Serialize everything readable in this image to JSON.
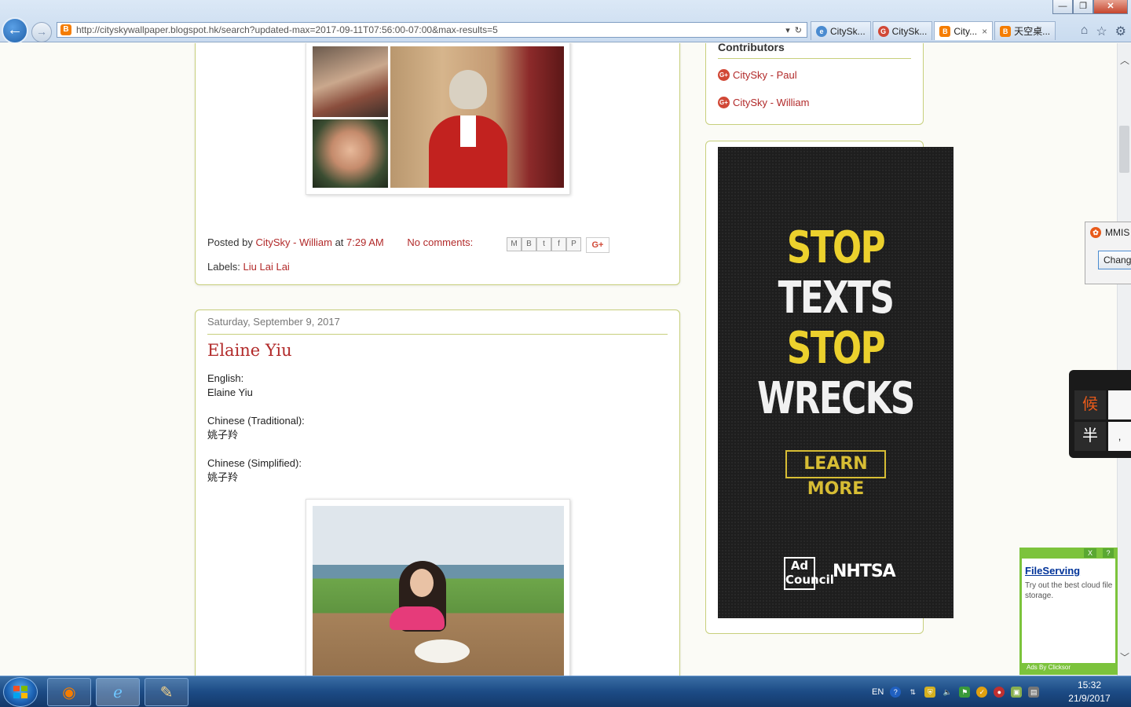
{
  "browser": {
    "url": "http://cityskywallpaper.blogspot.hk/search?updated-max=2017-09-11T07:56:00-07:00&max-results=5",
    "tabs": [
      {
        "label": "CitySk..."
      },
      {
        "label": "CitySk..."
      },
      {
        "label": "City...",
        "close": "×"
      },
      {
        "label": "天空桌..."
      }
    ],
    "window_controls": {
      "minimize": "—",
      "maximize": "❐",
      "close": "✕"
    }
  },
  "post_prev": {
    "posted_by_prefix": "Posted by",
    "author": "CitySky - William",
    "at": "at",
    "time": "7:29 AM",
    "comments": "No comments:",
    "share": {
      "email": "M",
      "blog": "B",
      "twitter": "t",
      "facebook": "f",
      "pinterest": "P",
      "gplus": "G+"
    },
    "labels_prefix": "Labels:",
    "label": "Liu Lai Lai"
  },
  "post": {
    "date": "Saturday, September 9, 2017",
    "title": "Elaine Yiu",
    "english_label": "English:",
    "english_value": "Elaine Yiu",
    "trad_label": "Chinese (Traditional):",
    "trad_value": "姚子羚",
    "simp_label": "Chinese (Simplified):",
    "simp_value": "姚子羚"
  },
  "sidebar": {
    "contributors_title": "Contributors",
    "contributors": [
      "CitySky - Paul",
      "CitySky - William"
    ]
  },
  "ad": {
    "line1": "STOP",
    "line2": "TEXTS",
    "line3": "STOP",
    "line4": "WRECKS",
    "cta": "LEARN MORE",
    "logo1": "Ad Council",
    "logo2": "NHTSA"
  },
  "mmis": {
    "title": "MMIS",
    "button": "Change"
  },
  "ime": {
    "key1": "候",
    "key2": "半",
    "side2": ","
  },
  "clicksor": {
    "close": "X",
    "help": "?",
    "headline": "FileServing",
    "body": "Try out the best cloud file storage.",
    "footer": "Ads By Clicksor"
  },
  "taskbar": {
    "lang": "EN",
    "time": "15:32",
    "date": "21/9/2017"
  },
  "colors": {
    "accent_red": "#b22a2a",
    "border_green": "#c7cf7c",
    "blogger_orange": "#f57d00"
  }
}
